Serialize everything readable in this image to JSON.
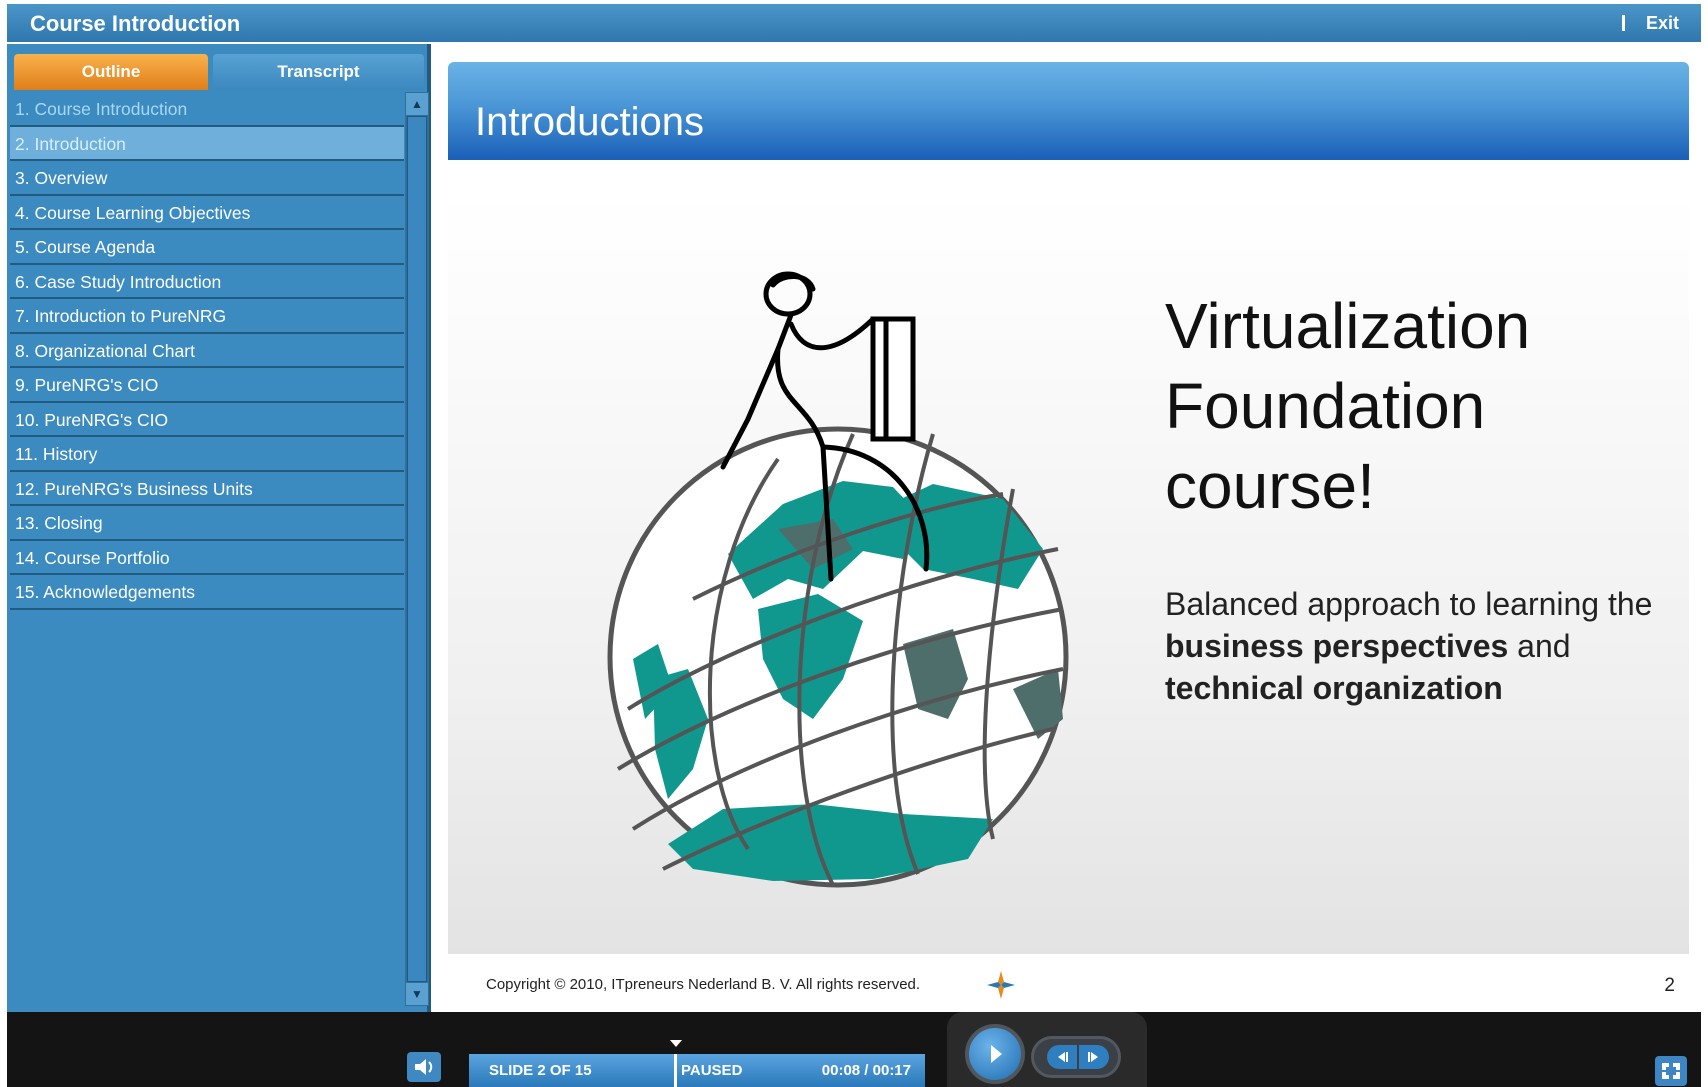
{
  "app": {
    "title": "Course Introduction",
    "exit_label": "Exit"
  },
  "tabs": {
    "outline": "Outline",
    "transcript": "Transcript",
    "active": "Outline"
  },
  "outline": [
    {
      "label": "1. Course Introduction",
      "state": "visited"
    },
    {
      "label": "2. Introduction",
      "state": "current"
    },
    {
      "label": "3. Overview",
      "state": "normal"
    },
    {
      "label": "4. Course Learning Objectives",
      "state": "normal"
    },
    {
      "label": "5. Course Agenda",
      "state": "normal"
    },
    {
      "label": "6. Case Study Introduction",
      "state": "normal"
    },
    {
      "label": "7. Introduction to PureNRG",
      "state": "normal"
    },
    {
      "label": "8. Organizational Chart",
      "state": "normal"
    },
    {
      "label": "9. PureNRG's CIO",
      "state": "normal"
    },
    {
      "label": "10. PureNRG's CIO",
      "state": "normal"
    },
    {
      "label": "11. History",
      "state": "normal"
    },
    {
      "label": "12. PureNRG's Business Units",
      "state": "normal"
    },
    {
      "label": "13. Closing",
      "state": "normal"
    },
    {
      "label": "14. Course Portfolio",
      "state": "normal"
    },
    {
      "label": "15. Acknowledgements",
      "state": "normal"
    }
  ],
  "slide": {
    "title": "Introductions",
    "heading": "Virtualization Foundation course!",
    "body_prefix": "Balanced approach to learning the ",
    "body_bold_1": "business perspectives",
    "body_middle": " and ",
    "body_bold_2": "technical organization",
    "copyright": "Copyright © 2010, ITpreneurs Nederland B. V. All rights reserved.",
    "page_number": "2"
  },
  "player": {
    "slide_count": "SLIDE 2 OF 15",
    "status": "PAUSED",
    "time": "00:08 / 00:17",
    "progress_fraction": 0.47
  },
  "colors": {
    "title_bar": "#3b88c0",
    "sidebar": "#3b8ac0",
    "tab_active": "#f39c2f",
    "globe_land": "#10988f",
    "globe_land_dark": "#4e6e6c"
  },
  "icons": {
    "volume": "speaker-icon",
    "play": "play-icon",
    "previous": "step-back-icon",
    "next": "step-forward-icon",
    "fullscreen": "fullscreen-icon",
    "logo": "itpreneurs-logo-icon"
  }
}
